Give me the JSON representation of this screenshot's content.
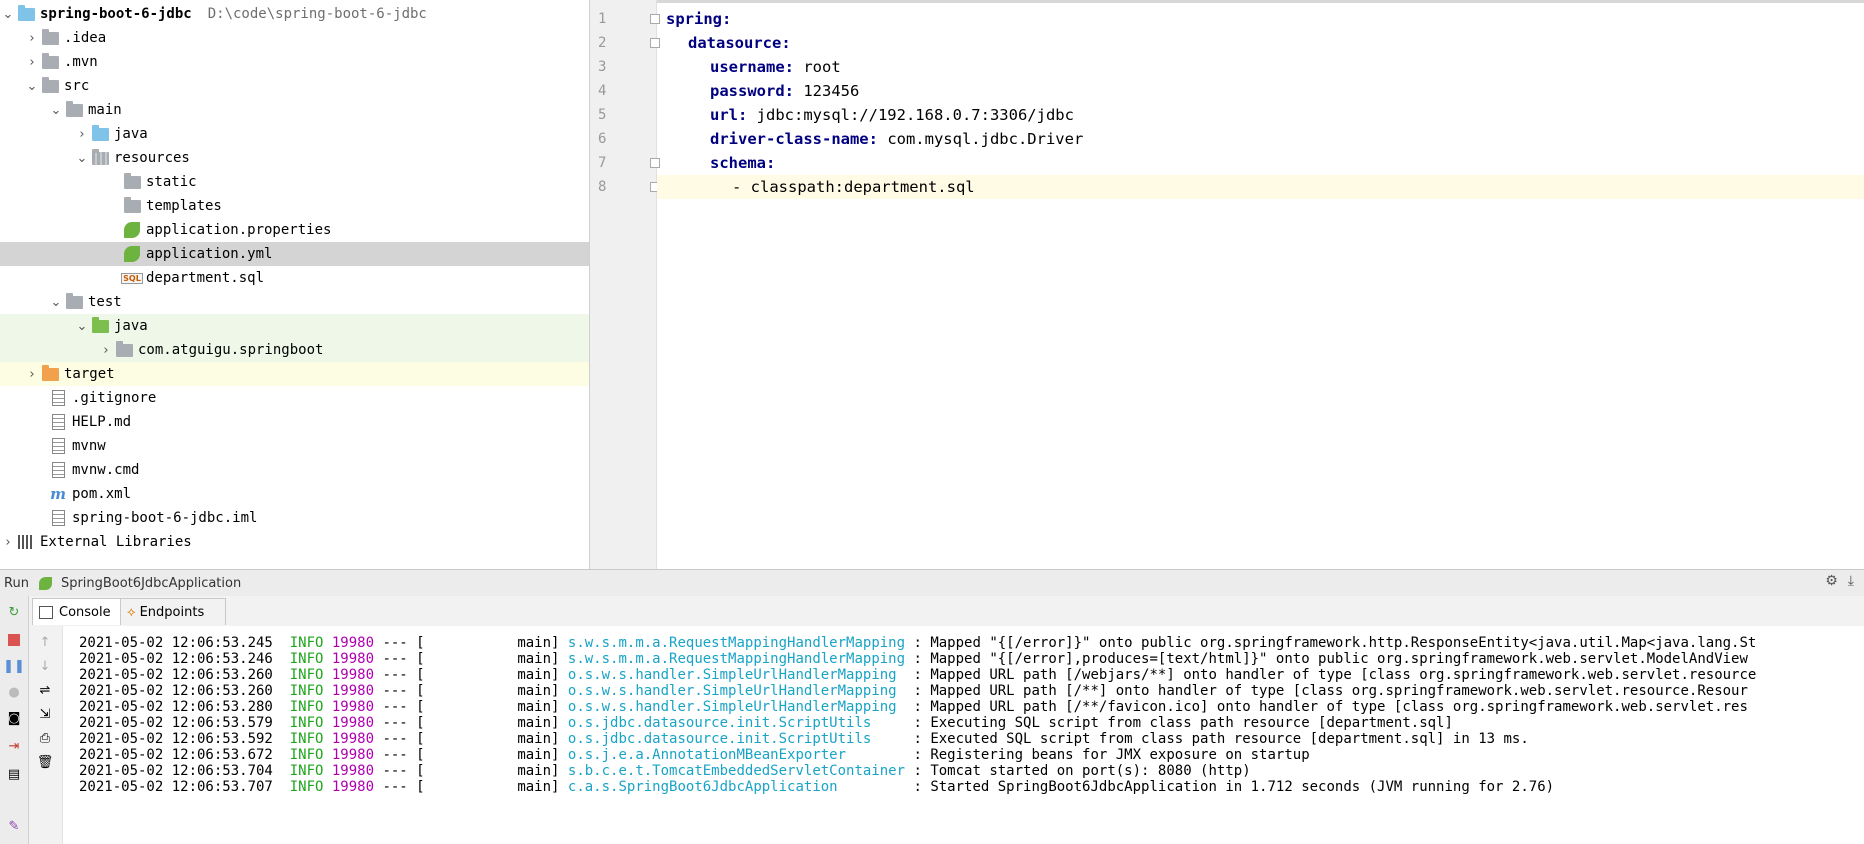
{
  "project": {
    "root_name": "spring-boot-6-jdbc",
    "root_path": "D:\\code\\spring-boot-6-jdbc",
    "nodes": [
      {
        "label": ".idea"
      },
      {
        "label": ".mvn"
      },
      {
        "label": "src"
      },
      {
        "label": "main"
      },
      {
        "label": "java"
      },
      {
        "label": "resources"
      },
      {
        "label": "static"
      },
      {
        "label": "templates"
      },
      {
        "label": "application.properties"
      },
      {
        "label": "application.yml"
      },
      {
        "label": "department.sql"
      },
      {
        "label": "test"
      },
      {
        "label": "java"
      },
      {
        "label": "com.atguigu.springboot"
      },
      {
        "label": "target"
      },
      {
        "label": ".gitignore"
      },
      {
        "label": "HELP.md"
      },
      {
        "label": "mvnw"
      },
      {
        "label": "mvnw.cmd"
      },
      {
        "label": "pom.xml"
      },
      {
        "label": "spring-boot-6-jdbc.iml"
      },
      {
        "label": "External Libraries"
      }
    ]
  },
  "editor": {
    "lines": [
      {
        "num": "1",
        "key": "spring:",
        "value": ""
      },
      {
        "num": "2",
        "key": "datasource:",
        "value": ""
      },
      {
        "num": "3",
        "key": "username:",
        "value": " root"
      },
      {
        "num": "4",
        "key": "password:",
        "value": " 123456"
      },
      {
        "num": "5",
        "key": "url:",
        "value": " jdbc:mysql://192.168.0.7:3306/jdbc"
      },
      {
        "num": "6",
        "key": "driver-class-name:",
        "value": " com.mysql.jdbc.Driver"
      },
      {
        "num": "7",
        "key": "schema:",
        "value": ""
      },
      {
        "num": "8",
        "key": "",
        "value": "- classpath:department.sql"
      }
    ]
  },
  "run": {
    "label": "Run",
    "config": "SpringBoot6JdbcApplication",
    "tabs": [
      "Console",
      "Endpoints"
    ]
  },
  "console": {
    "lines": [
      {
        "ts": "2021-05-02 12:06:53.245",
        "level": "INFO",
        "pid": "19980",
        "sep": "---",
        "thread": "[           main]",
        "logger": "s.w.s.m.m.a.RequestMappingHandlerMapping",
        "msg": ": Mapped \"{[/error]}\" onto public org.springframework.http.ResponseEntity<java.util.Map<java.lang.St"
      },
      {
        "ts": "2021-05-02 12:06:53.246",
        "level": "INFO",
        "pid": "19980",
        "sep": "---",
        "thread": "[           main]",
        "logger": "s.w.s.m.m.a.RequestMappingHandlerMapping",
        "msg": ": Mapped \"{[/error],produces=[text/html]}\" onto public org.springframework.web.servlet.ModelAndView"
      },
      {
        "ts": "2021-05-02 12:06:53.260",
        "level": "INFO",
        "pid": "19980",
        "sep": "---",
        "thread": "[           main]",
        "logger": "o.s.w.s.handler.SimpleUrlHandlerMapping ",
        "msg": ": Mapped URL path [/webjars/**] onto handler of type [class org.springframework.web.servlet.resource"
      },
      {
        "ts": "2021-05-02 12:06:53.260",
        "level": "INFO",
        "pid": "19980",
        "sep": "---",
        "thread": "[           main]",
        "logger": "o.s.w.s.handler.SimpleUrlHandlerMapping ",
        "msg": ": Mapped URL path [/**] onto handler of type [class org.springframework.web.servlet.resource.Resour"
      },
      {
        "ts": "2021-05-02 12:06:53.280",
        "level": "INFO",
        "pid": "19980",
        "sep": "---",
        "thread": "[           main]",
        "logger": "o.s.w.s.handler.SimpleUrlHandlerMapping ",
        "msg": ": Mapped URL path [/**/favicon.ico] onto handler of type [class org.springframework.web.servlet.res"
      },
      {
        "ts": "2021-05-02 12:06:53.579",
        "level": "INFO",
        "pid": "19980",
        "sep": "---",
        "thread": "[           main]",
        "logger": "o.s.jdbc.datasource.init.ScriptUtils    ",
        "msg": ": Executing SQL script from class path resource [department.sql]"
      },
      {
        "ts": "2021-05-02 12:06:53.592",
        "level": "INFO",
        "pid": "19980",
        "sep": "---",
        "thread": "[           main]",
        "logger": "o.s.jdbc.datasource.init.ScriptUtils    ",
        "msg": ": Executed SQL script from class path resource [department.sql] in 13 ms."
      },
      {
        "ts": "2021-05-02 12:06:53.672",
        "level": "INFO",
        "pid": "19980",
        "sep": "---",
        "thread": "[           main]",
        "logger": "o.s.j.e.a.AnnotationMBeanExporter       ",
        "msg": ": Registering beans for JMX exposure on startup"
      },
      {
        "ts": "2021-05-02 12:06:53.704",
        "level": "INFO",
        "pid": "19980",
        "sep": "---",
        "thread": "[           main]",
        "logger": "s.b.c.e.t.TomcatEmbeddedServletContainer",
        "msg": ": Tomcat started on port(s): 8080 (http)"
      },
      {
        "ts": "2021-05-02 12:06:53.707",
        "level": "INFO",
        "pid": "19980",
        "sep": "---",
        "thread": "[           main]",
        "logger": "c.a.s.SpringBoot6JdbcApplication        ",
        "msg": ": Started SpringBoot6JdbcApplication in 1.712 seconds (JVM running for 2.76)"
      }
    ]
  }
}
